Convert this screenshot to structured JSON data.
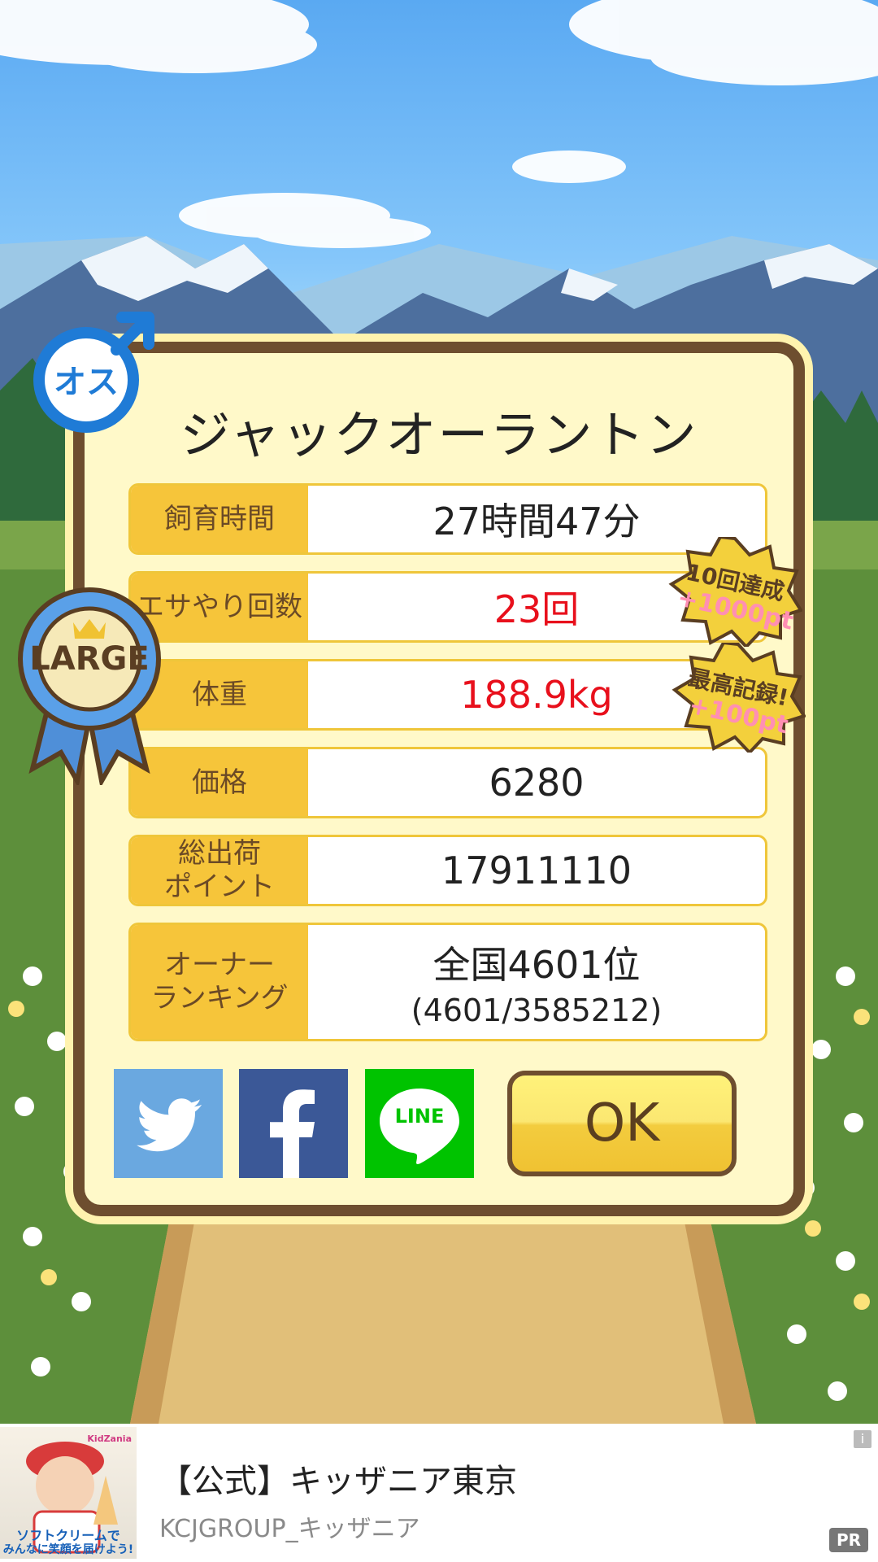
{
  "gender_badge": {
    "text": "オス"
  },
  "size_ribbon": {
    "text": "LARGE"
  },
  "pet_name": "ジャックオーラントン",
  "stats": [
    {
      "label": "飼育時間",
      "value": "27時間47分"
    },
    {
      "label": "エサやり回数",
      "value": "23回"
    },
    {
      "label": "体重",
      "value": "188.9kg"
    },
    {
      "label": "価格",
      "value": "6280"
    },
    {
      "label": "総出荷\nポイント",
      "value": "17911110"
    },
    {
      "label": "オーナー\nランキング",
      "value": "全国4601位",
      "sub": "(4601/3585212)"
    }
  ],
  "bonus_badges": [
    {
      "line1": "10回達成",
      "line2": "+1000pt"
    },
    {
      "line1": "最高記録!",
      "line2": "+100pt"
    }
  ],
  "share": {
    "twitter_color": "#6aa8e0",
    "facebook_color": "#3b5897",
    "line_color": "#00c300",
    "line_label": "LINE"
  },
  "ok_label": "OK",
  "ad": {
    "title": "【公式】キッザニア東京",
    "advertiser": "KCJGROUP_キッザニア",
    "thumb_caption_1": "ソフトクリームで",
    "thumb_caption_2": "みんなに笑顔を届けよう!",
    "thumb_logo": "KidZania",
    "pr_label": "PR",
    "info_label": "i"
  },
  "colors": {
    "panel_border": "#6e4e2f",
    "label_bg": "#f6c53a",
    "highlight_value": "#e8101c"
  }
}
